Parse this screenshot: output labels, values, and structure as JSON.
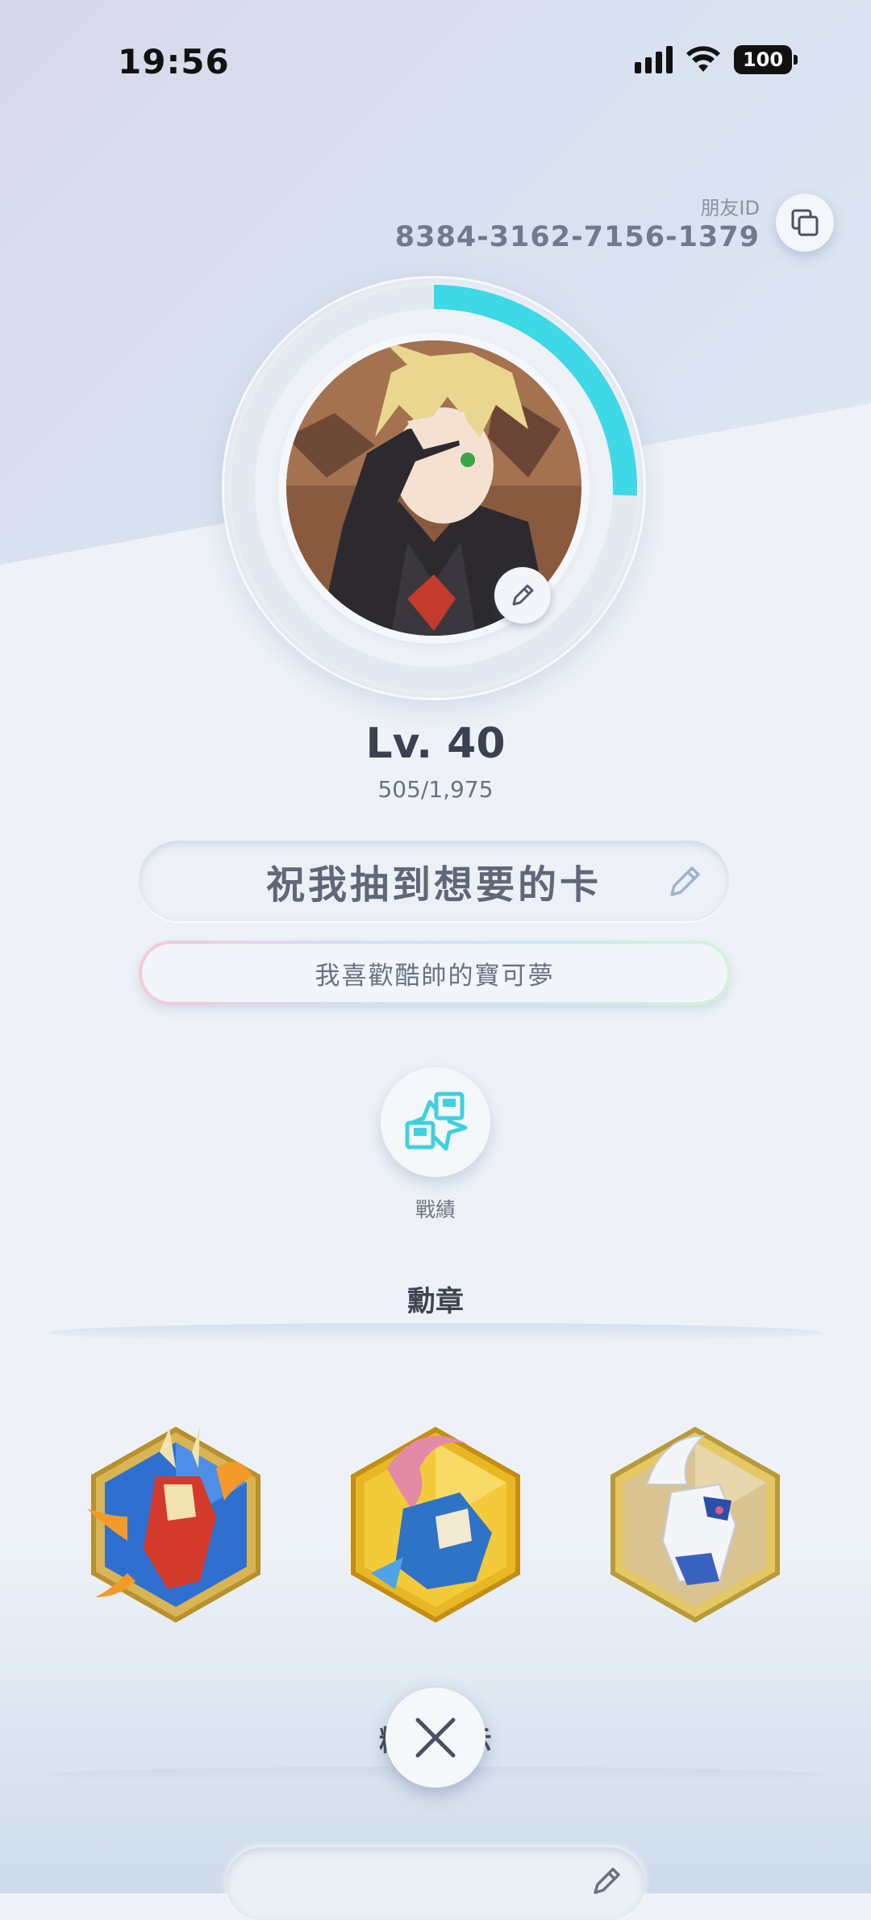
{
  "status_bar": {
    "time": "19:56",
    "battery": "100"
  },
  "profile": {
    "friend_id_label": "朋友ID",
    "friend_id": "8384-3162-7156-1379",
    "level": "Lv. 40",
    "experience": "505/1,975",
    "experience_progress": 0.256,
    "motto": "祝我抽到想要的卡",
    "subtitle": "我喜歡酷帥的寶可夢"
  },
  "actions": {
    "record_label": "戰績"
  },
  "medals": {
    "title": "勳章",
    "items": [
      {
        "name": "Mega Blaziken medal",
        "frame": "blue"
      },
      {
        "name": "Greninja medal",
        "frame": "gold"
      },
      {
        "name": "Lugia medal",
        "frame": "gold"
      }
    ]
  },
  "bottom": {
    "partial_label": "精選展示"
  },
  "colors": {
    "accent_cyan": "#3fd8e6",
    "text_dark": "#3b4150",
    "text_muted": "#6a7282"
  }
}
